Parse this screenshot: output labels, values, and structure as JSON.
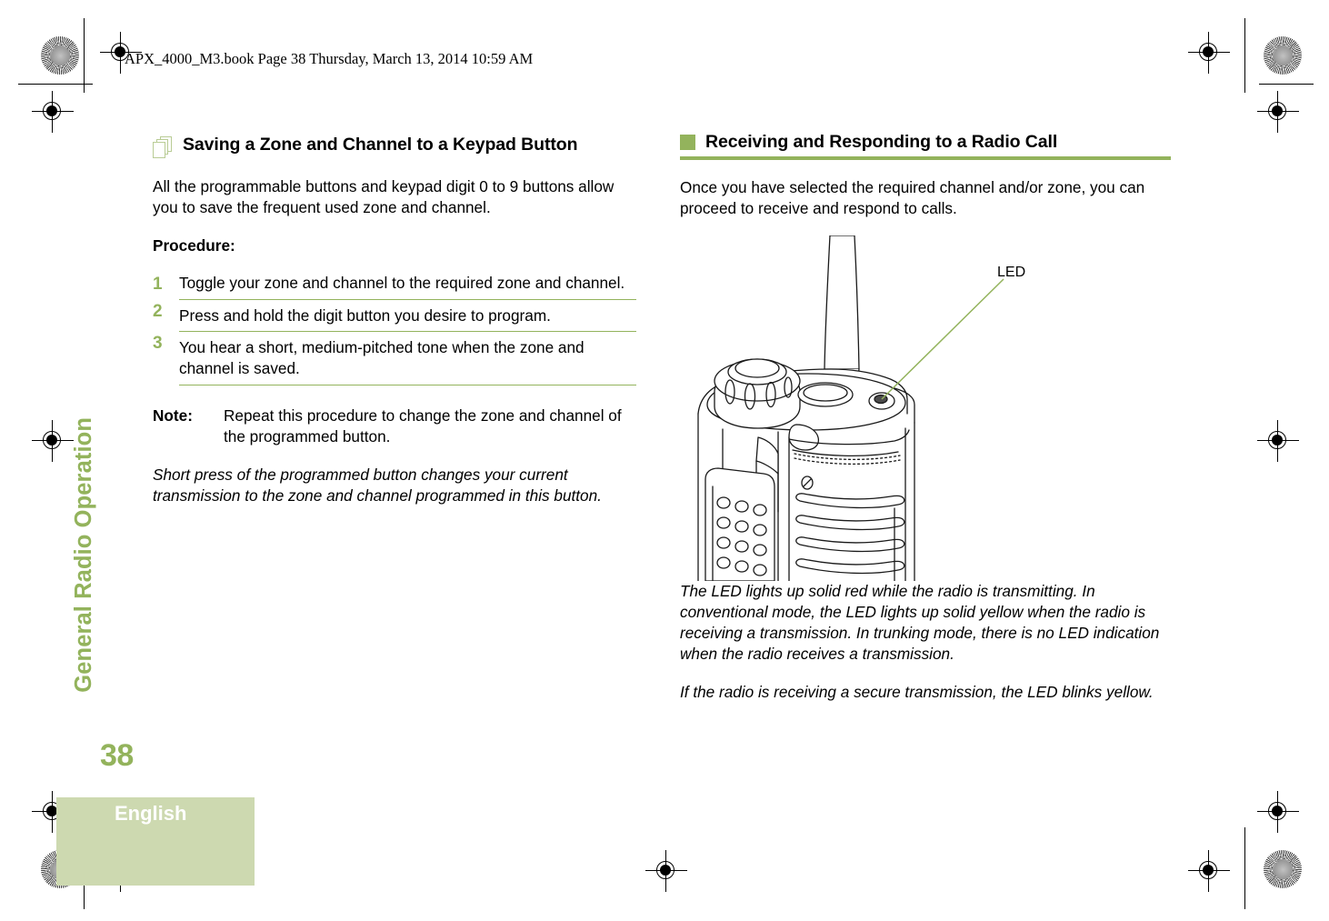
{
  "header": {
    "file_line": "APX_4000_M3.book  Page 38  Thursday, March 13, 2014  10:59 AM"
  },
  "sidebar": {
    "chapter_title": "General Radio Operation",
    "page_number": "38",
    "language": "English"
  },
  "colors": {
    "accent_green": "#93b35c",
    "pale_green_block": "#cdd9b0",
    "icon_outline_green": "#b9cc95"
  },
  "left_column": {
    "heading": "Saving a Zone and Channel to a Keypad Button",
    "heading_icon": "stacked-pages-icon",
    "intro": "All the programmable buttons and keypad digit 0 to 9 buttons allow you to save the frequent used zone and channel.",
    "procedure_label": "Procedure:",
    "steps": [
      {
        "number": "1",
        "text": "Toggle your zone and channel to the required zone and channel."
      },
      {
        "number": "2",
        "text": "Press and hold the digit button you desire to program."
      },
      {
        "number": "3",
        "text": "You hear a short, medium-pitched tone when the zone and channel is saved."
      }
    ],
    "note_label": "Note:",
    "note_text": "Repeat this procedure to change the zone and channel of the programmed button.",
    "italic_note": "Short press of the programmed button changes your current transmission to the zone and channel programmed in this button."
  },
  "right_column": {
    "heading": "Receiving and Responding to a Radio Call",
    "heading_bullet": "green-square-bullet",
    "intro": "Once you have selected the required channel and/or zone, you can proceed to receive and respond to calls.",
    "figure": {
      "name": "portable-radio-top-illustration",
      "callout_label": "LED"
    },
    "paragraphs": [
      "The LED lights up solid red while the radio is transmitting. In conventional mode, the LED lights up solid yellow when the radio is receiving a transmission. In trunking mode, there is no LED indication when the radio receives a transmission.",
      "If the radio is receiving a secure transmission, the LED blinks yellow."
    ]
  }
}
